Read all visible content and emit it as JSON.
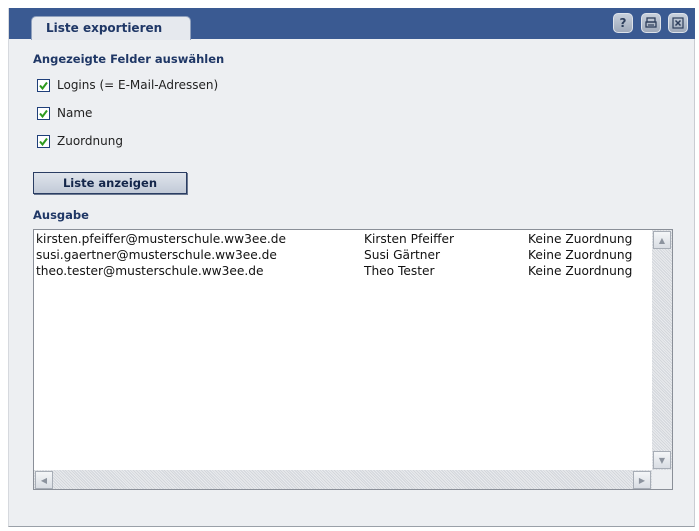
{
  "window": {
    "tab_title": "Liste exportieren",
    "buttons": {
      "help": "?",
      "print_icon": "print-icon",
      "close_icon": "close-icon"
    }
  },
  "fields": {
    "heading": "Angezeigte Felder auswählen",
    "options": [
      {
        "label": "Logins (= E-Mail-Adressen)",
        "checked": true
      },
      {
        "label": "Name",
        "checked": true
      },
      {
        "label": "Zuordnung",
        "checked": true
      }
    ]
  },
  "actions": {
    "show_list": "Liste anzeigen"
  },
  "output": {
    "heading": "Ausgabe",
    "rows": [
      {
        "login": "kirsten.pfeiffer@musterschule.ww3ee.de",
        "name": "Kirsten Pfeiffer",
        "assignment": "Keine Zuordnung"
      },
      {
        "login": "susi.gaertner@musterschule.ww3ee.de",
        "name": "Susi Gärtner",
        "assignment": "Keine Zuordnung"
      },
      {
        "login": "theo.tester@musterschule.ww3ee.de",
        "name": "Theo Tester",
        "assignment": "Keine Zuordnung"
      }
    ]
  },
  "colors": {
    "titlebar": "#3a5a92",
    "panel": "#edeff2",
    "heading_text": "#1f3766",
    "checkbox_check": "#2e9a1e"
  }
}
